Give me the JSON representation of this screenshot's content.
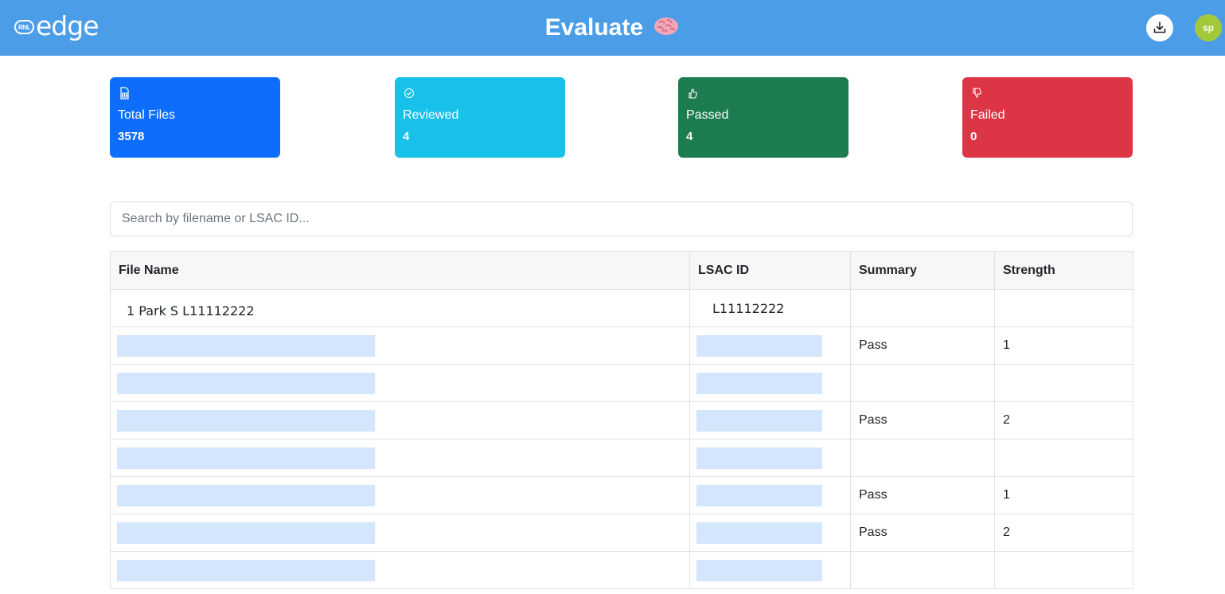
{
  "header": {
    "logo_badge": "RNL",
    "logo_text": "edge",
    "title": "Evaluate",
    "title_emoji": "brain-icon",
    "download_icon": "download-icon",
    "avatar_initials": "sp",
    "bar_color": "#4c9de8",
    "avatar_color": "#a3c93a"
  },
  "stats": [
    {
      "icon": "file-spreadsheet-icon",
      "label": "Total Files",
      "value": "3578",
      "color": "#0d6efd"
    },
    {
      "icon": "check-circle-icon",
      "label": "Reviewed",
      "value": "4",
      "color": "#17c1ea"
    },
    {
      "icon": "thumbs-up-icon",
      "label": "Passed",
      "value": "4",
      "color": "#1c7c4f"
    },
    {
      "icon": "thumbs-down-icon",
      "label": "Failed",
      "value": "0",
      "color": "#dc3545"
    }
  ],
  "search": {
    "placeholder": "Search by filename or LSAC ID..."
  },
  "table": {
    "columns": [
      "File Name",
      "LSAC ID",
      "Summary",
      "Strength"
    ],
    "rows": [
      {
        "file_name": "1 Park S L11112222",
        "lsac_id": "L11112222",
        "summary": "",
        "strength": ""
      },
      {
        "file_name": "",
        "lsac_id": "",
        "summary": "Pass",
        "strength": "1"
      },
      {
        "file_name": "",
        "lsac_id": "",
        "summary": "",
        "strength": ""
      },
      {
        "file_name": "",
        "lsac_id": "",
        "summary": "Pass",
        "strength": "2"
      },
      {
        "file_name": "",
        "lsac_id": "",
        "summary": "",
        "strength": ""
      },
      {
        "file_name": "",
        "lsac_id": "",
        "summary": "Pass",
        "strength": "1"
      },
      {
        "file_name": "",
        "lsac_id": "",
        "summary": "Pass",
        "strength": "2"
      },
      {
        "file_name": "",
        "lsac_id": "",
        "summary": "",
        "strength": ""
      }
    ]
  }
}
